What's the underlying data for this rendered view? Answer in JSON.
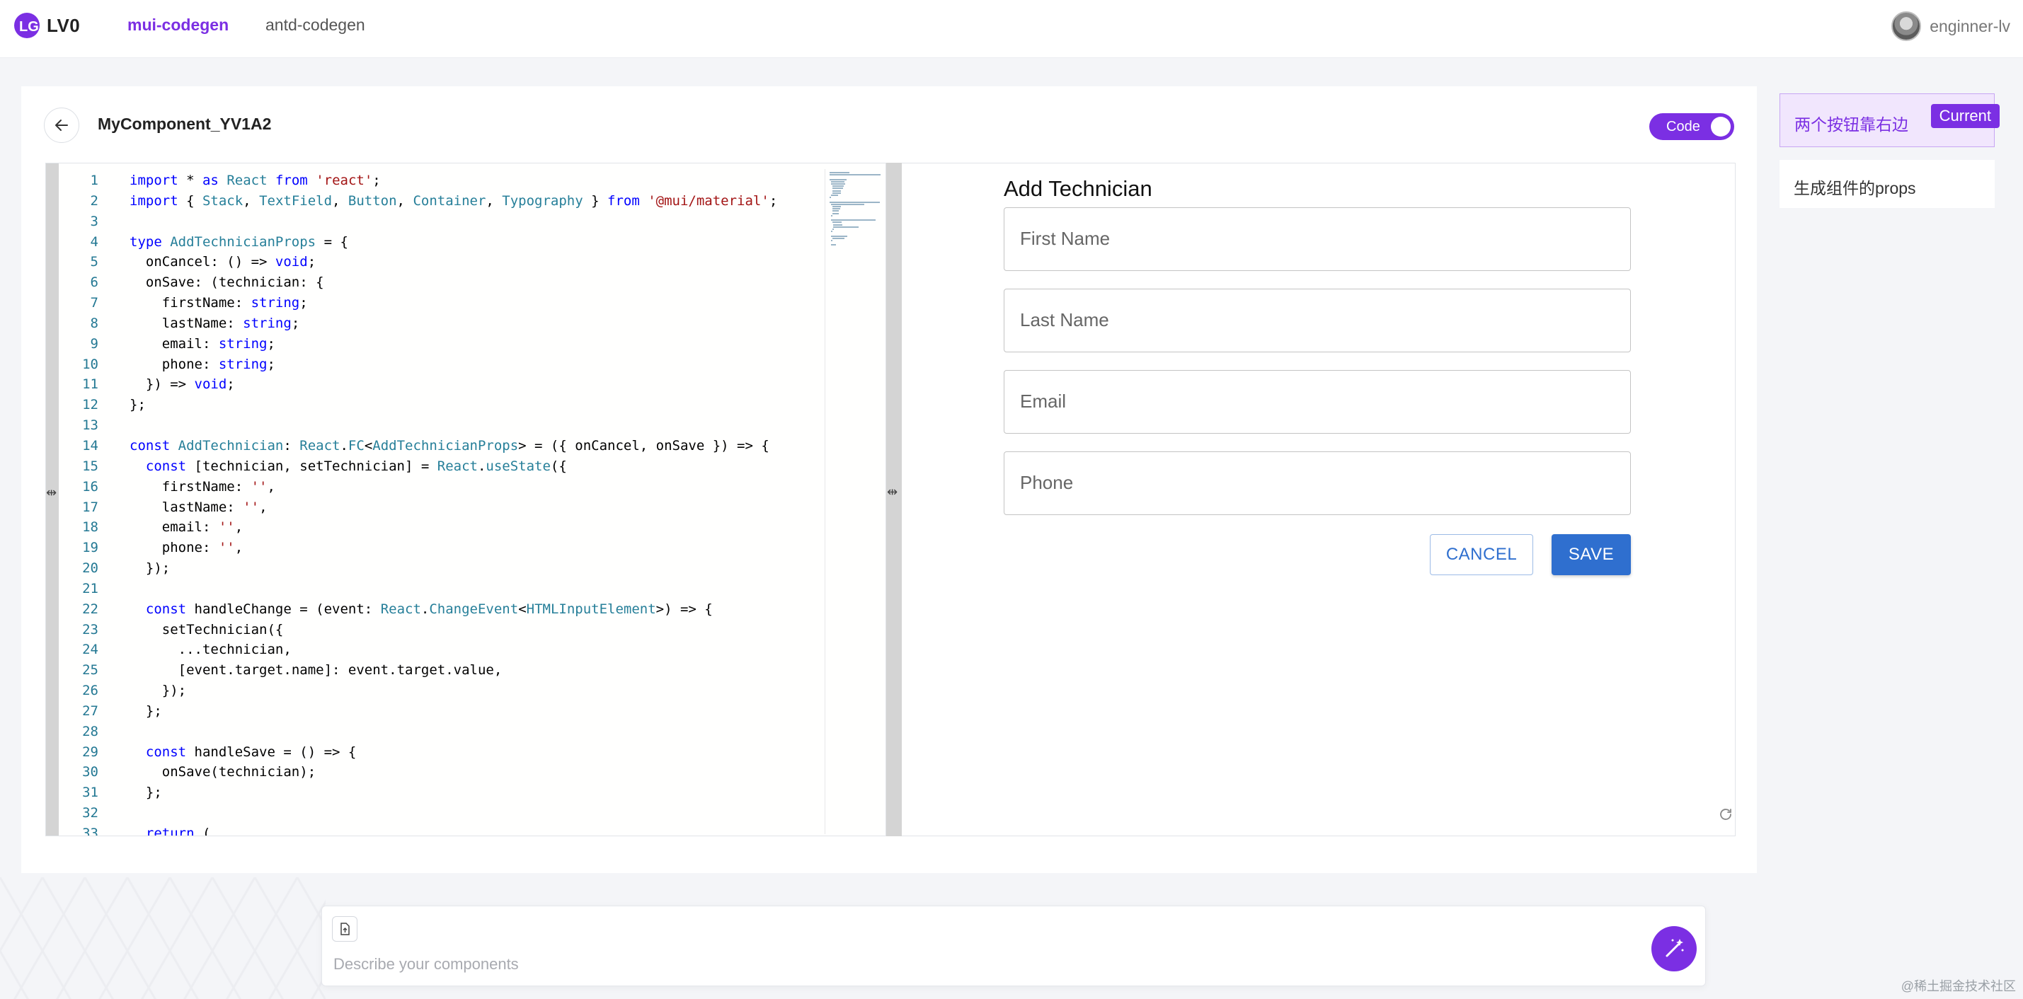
{
  "app": {
    "logo_text": "LV0"
  },
  "nav": {
    "items": [
      {
        "label": "mui-codegen",
        "active": true
      },
      {
        "label": "antd-codegen",
        "active": false
      }
    ]
  },
  "user": {
    "name": "enginner-lv"
  },
  "component": {
    "title": "MyComponent_YV1A2",
    "toggle_label": "Code",
    "toggle_on": true
  },
  "editor": {
    "line_numbers": [
      "1",
      "2",
      "3",
      "4",
      "5",
      "6",
      "7",
      "8",
      "9",
      "10",
      "11",
      "12",
      "13",
      "14",
      "15",
      "16",
      "17",
      "18",
      "19",
      "20",
      "21",
      "22",
      "23",
      "24",
      "25",
      "26",
      "27",
      "28",
      "29",
      "30",
      "31",
      "32",
      "33"
    ],
    "lines": [
      "import * as React from 'react';",
      "import { Stack, TextField, Button, Container, Typography } from '@mui/material';",
      "",
      "type AddTechnicianProps = {",
      "  onCancel: () => void;",
      "  onSave: (technician: {",
      "    firstName: string;",
      "    lastName: string;",
      "    email: string;",
      "    phone: string;",
      "  }) => void;",
      "};",
      "",
      "const AddTechnician: React.FC<AddTechnicianProps> = ({ onCancel, onSave }) => {",
      "  const [technician, setTechnician] = React.useState({",
      "    firstName: '',",
      "    lastName: '',",
      "    email: '',",
      "    phone: '',",
      "  });",
      "",
      "  const handleChange = (event: React.ChangeEvent<HTMLInputElement>) => {",
      "    setTechnician({",
      "      ...technician,",
      "      [event.target.name]: event.target.value,",
      "    });",
      "  };",
      "",
      "  const handleSave = () => {",
      "    onSave(technician);",
      "  };",
      "",
      "  return ("
    ]
  },
  "preview": {
    "form_title": "Add Technician",
    "fields": [
      "First Name",
      "Last Name",
      "Email",
      "Phone"
    ],
    "cancel_label": "CANCEL",
    "save_label": "SAVE"
  },
  "history": {
    "items": [
      {
        "label": "两个按钮靠右边",
        "current": true
      },
      {
        "label": "生成组件的props",
        "current": false
      }
    ],
    "current_badge": "Current"
  },
  "prompt": {
    "placeholder": "Describe your components",
    "value": ""
  },
  "watermark": "@稀土掘金技术社区",
  "colors": {
    "accent": "#7b2fe3",
    "mui_primary": "#2f6fcf"
  },
  "icons": [
    "logo-icon",
    "back-arrow-icon",
    "refresh-icon",
    "file-upload-icon",
    "magic-wand-icon",
    "drag-handle-icon"
  ]
}
